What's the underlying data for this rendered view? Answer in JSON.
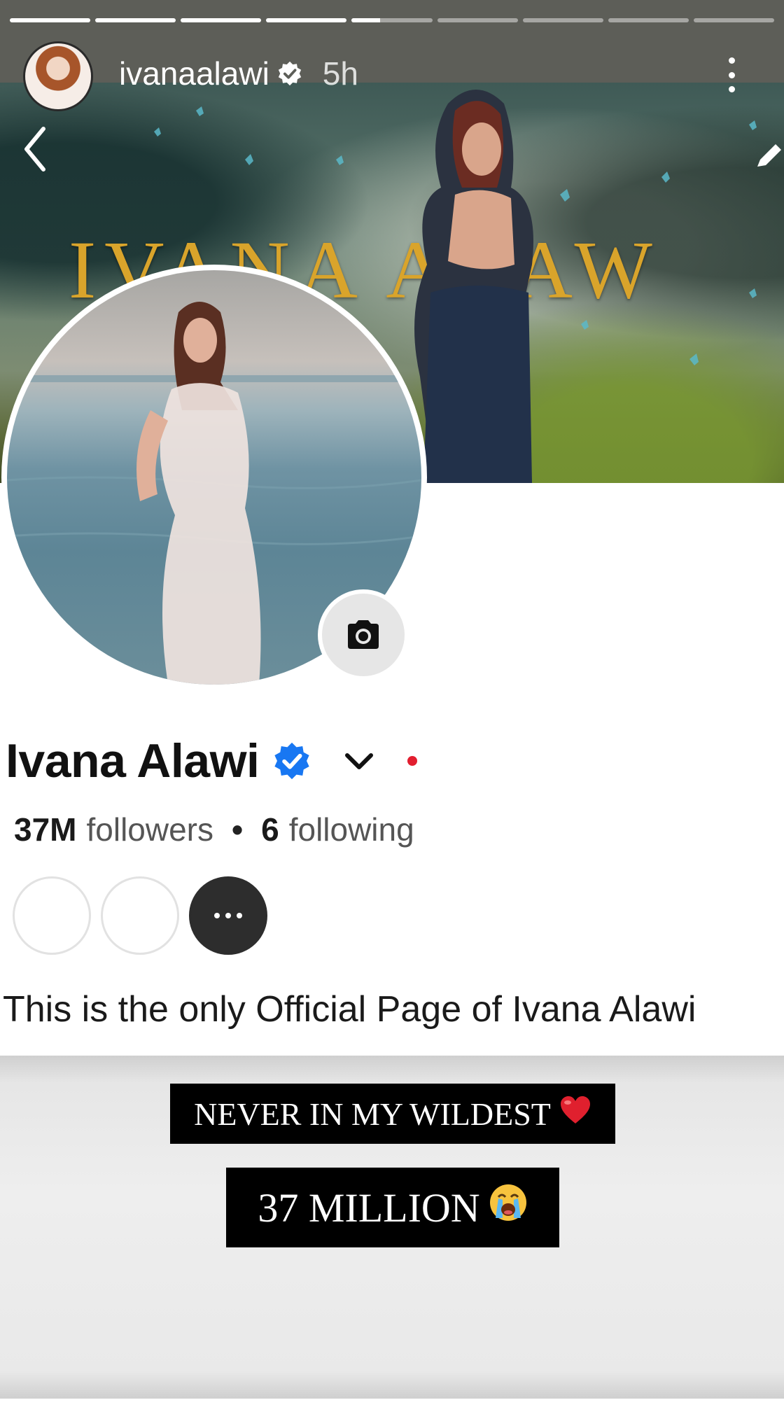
{
  "story": {
    "progress": [
      1,
      1,
      1,
      1,
      0.35,
      0,
      0,
      0,
      0
    ],
    "username": "ivanaalawi",
    "time": "5h"
  },
  "cover": {
    "title": "IVANA ALAW"
  },
  "profile": {
    "name": "Ivana Alawi",
    "followers_count": "37M",
    "followers_label": "followers",
    "separator": "•",
    "following_count": "6",
    "following_label": "following",
    "bio": "This is the only Official Page of Ivana Alawi"
  },
  "captions": {
    "line1": "NEVER IN MY WILDEST",
    "line1_emoji": "❤️",
    "line2": "37 MILLION",
    "line2_emoji": "😭"
  },
  "icons": {
    "verified": "verified-badge-icon",
    "back": "chevron-left-icon",
    "edit": "pencil-icon",
    "camera": "camera-icon",
    "dropdown": "chevron-down-icon",
    "more": "ellipsis-icon"
  },
  "colors": {
    "verified_blue": "#1877f2",
    "dot_red": "#e21e2f",
    "cover_gold": "#d9a42b"
  }
}
